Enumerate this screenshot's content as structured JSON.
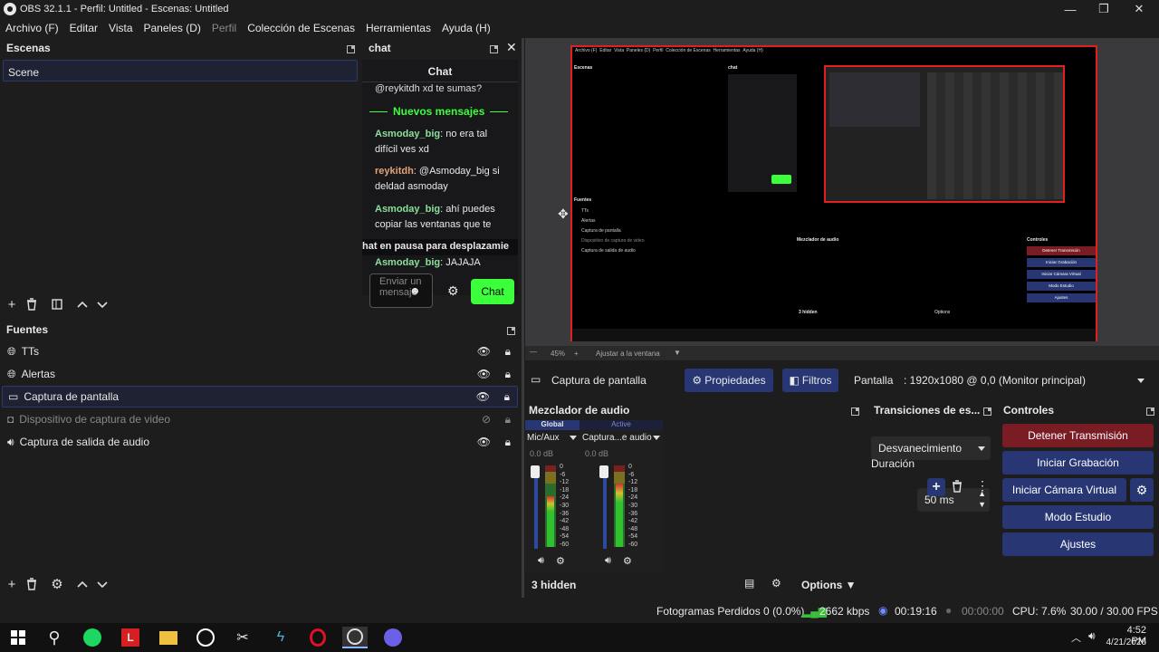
{
  "window": {
    "title": "OBS 32.1.1 - Perfil: Untitled - Escenas: Untitled"
  },
  "menu": [
    "Archivo (F)",
    "Editar",
    "Vista",
    "Paneles (D)",
    "Perfil",
    "Colección de Escenas",
    "Herramientas",
    "Ayuda (H)"
  ],
  "scenes": {
    "title": "Escenas",
    "items": [
      "Scene"
    ]
  },
  "chat": {
    "dock_title": "chat",
    "header": "Chat",
    "messages": [
      {
        "user": "",
        "text": "@reykitdh xd te sumas?"
      },
      {
        "user": "Asmoday_big",
        "text": ": no era tal difícil ves xd"
      },
      {
        "user": "reykitdh",
        "text": ": @Asmoday_big si deldad asmoday"
      },
      {
        "user": "Asmoday_big",
        "text": ": ahí puedes copiar las ventanas que te"
      },
      {
        "user": "Asmoday_big",
        "text": ": JAJAJA"
      }
    ],
    "new_messages": "Nuevos mensajes",
    "paused": "hat en pausa para desplazamie",
    "input_placeholder": "Enviar un mensaje",
    "send_label": "Chat",
    "colors": {
      "asmoday": "#8ae09a",
      "reykitdh": "#e2a37a",
      "accent": "#3cff3c"
    }
  },
  "sources": {
    "title": "Fuentes",
    "items": [
      {
        "label": "TTs",
        "icon": "globe-icon",
        "hidden": false
      },
      {
        "label": "Alertas",
        "icon": "globe-icon",
        "hidden": false
      },
      {
        "label": "Captura de pantalla",
        "icon": "monitor-icon",
        "hidden": false,
        "selected": true
      },
      {
        "label": "Dispositivo de captura de video",
        "icon": "camera-icon",
        "hidden": true
      },
      {
        "label": "Captura de salida de audio",
        "icon": "speaker-icon",
        "hidden": false
      }
    ]
  },
  "preview": {
    "zoom": "45%",
    "fit": "Ajustar a la ventana",
    "nested": {
      "menu": [
        "Archivo (F)",
        "Editar",
        "Vista",
        "Paneles (D)",
        "Perfil",
        "Colección de Escenas",
        "Herramientas",
        "Ayuda (H)"
      ],
      "scenes_title": "Escenas",
      "chat_title": "chat",
      "sources_title": "Fuentes",
      "source_items": [
        "TTs",
        "Alertas",
        "Captura de pantalla",
        "Dispositivo de captura de video",
        "Captura de salida de audio"
      ],
      "hidden_label": "3 hidden",
      "options_label": "Options",
      "mixer_title": "Mezclador de audio",
      "controls_title": "Controles",
      "controls": [
        "Detener Transmisión",
        "Iniciar Grabación",
        "Iniciar Cámara Virtual",
        "Modo Estudio",
        "Ajustes"
      ]
    }
  },
  "capture_bar": {
    "source_name": "Captura de pantalla",
    "properties": "Propiedades",
    "filters": "Filtros",
    "display_label": "Pantalla",
    "display_value": ": 1920x1080 @ 0,0 (Monitor principal)"
  },
  "mixer": {
    "title": "Mezclador de audio",
    "tab_global": "Global",
    "tab_active": "Active",
    "channels": [
      {
        "name": "Mic/Aux",
        "db": "0.0 dB",
        "level": 0.62
      },
      {
        "name": "Captura...e audio",
        "db": "0.0 dB",
        "level": 0.78
      }
    ],
    "scale": [
      "0",
      "-6",
      "-12",
      "-18",
      "-24",
      "-30",
      "-36",
      "-42",
      "-48",
      "-54",
      "-60"
    ],
    "hidden": "3 hidden",
    "options": "Options"
  },
  "transitions": {
    "title": "Transiciones de es...",
    "type": "Desvanecimiento",
    "duration_label": "Duración",
    "duration_value": "50 ms"
  },
  "controls": {
    "title": "Controles",
    "stop_stream": "Detener Transmisión",
    "start_recording": "Iniciar Grabación",
    "start_virtualcam": "Iniciar Cámara Virtual",
    "studio_mode": "Modo Estudio",
    "settings": "Ajustes"
  },
  "status": {
    "dropped": "Fotogramas Perdidos 0 (0.0%)",
    "bitrate": "2662 kbps",
    "stream_time": "00:19:16",
    "rec_time": "00:00:00",
    "cpu": "CPU: 7.6%",
    "fps": "30.00 / 30.00 FPS"
  },
  "taskbar": {
    "time": "4:52 PM",
    "date": "4/21/2026"
  }
}
